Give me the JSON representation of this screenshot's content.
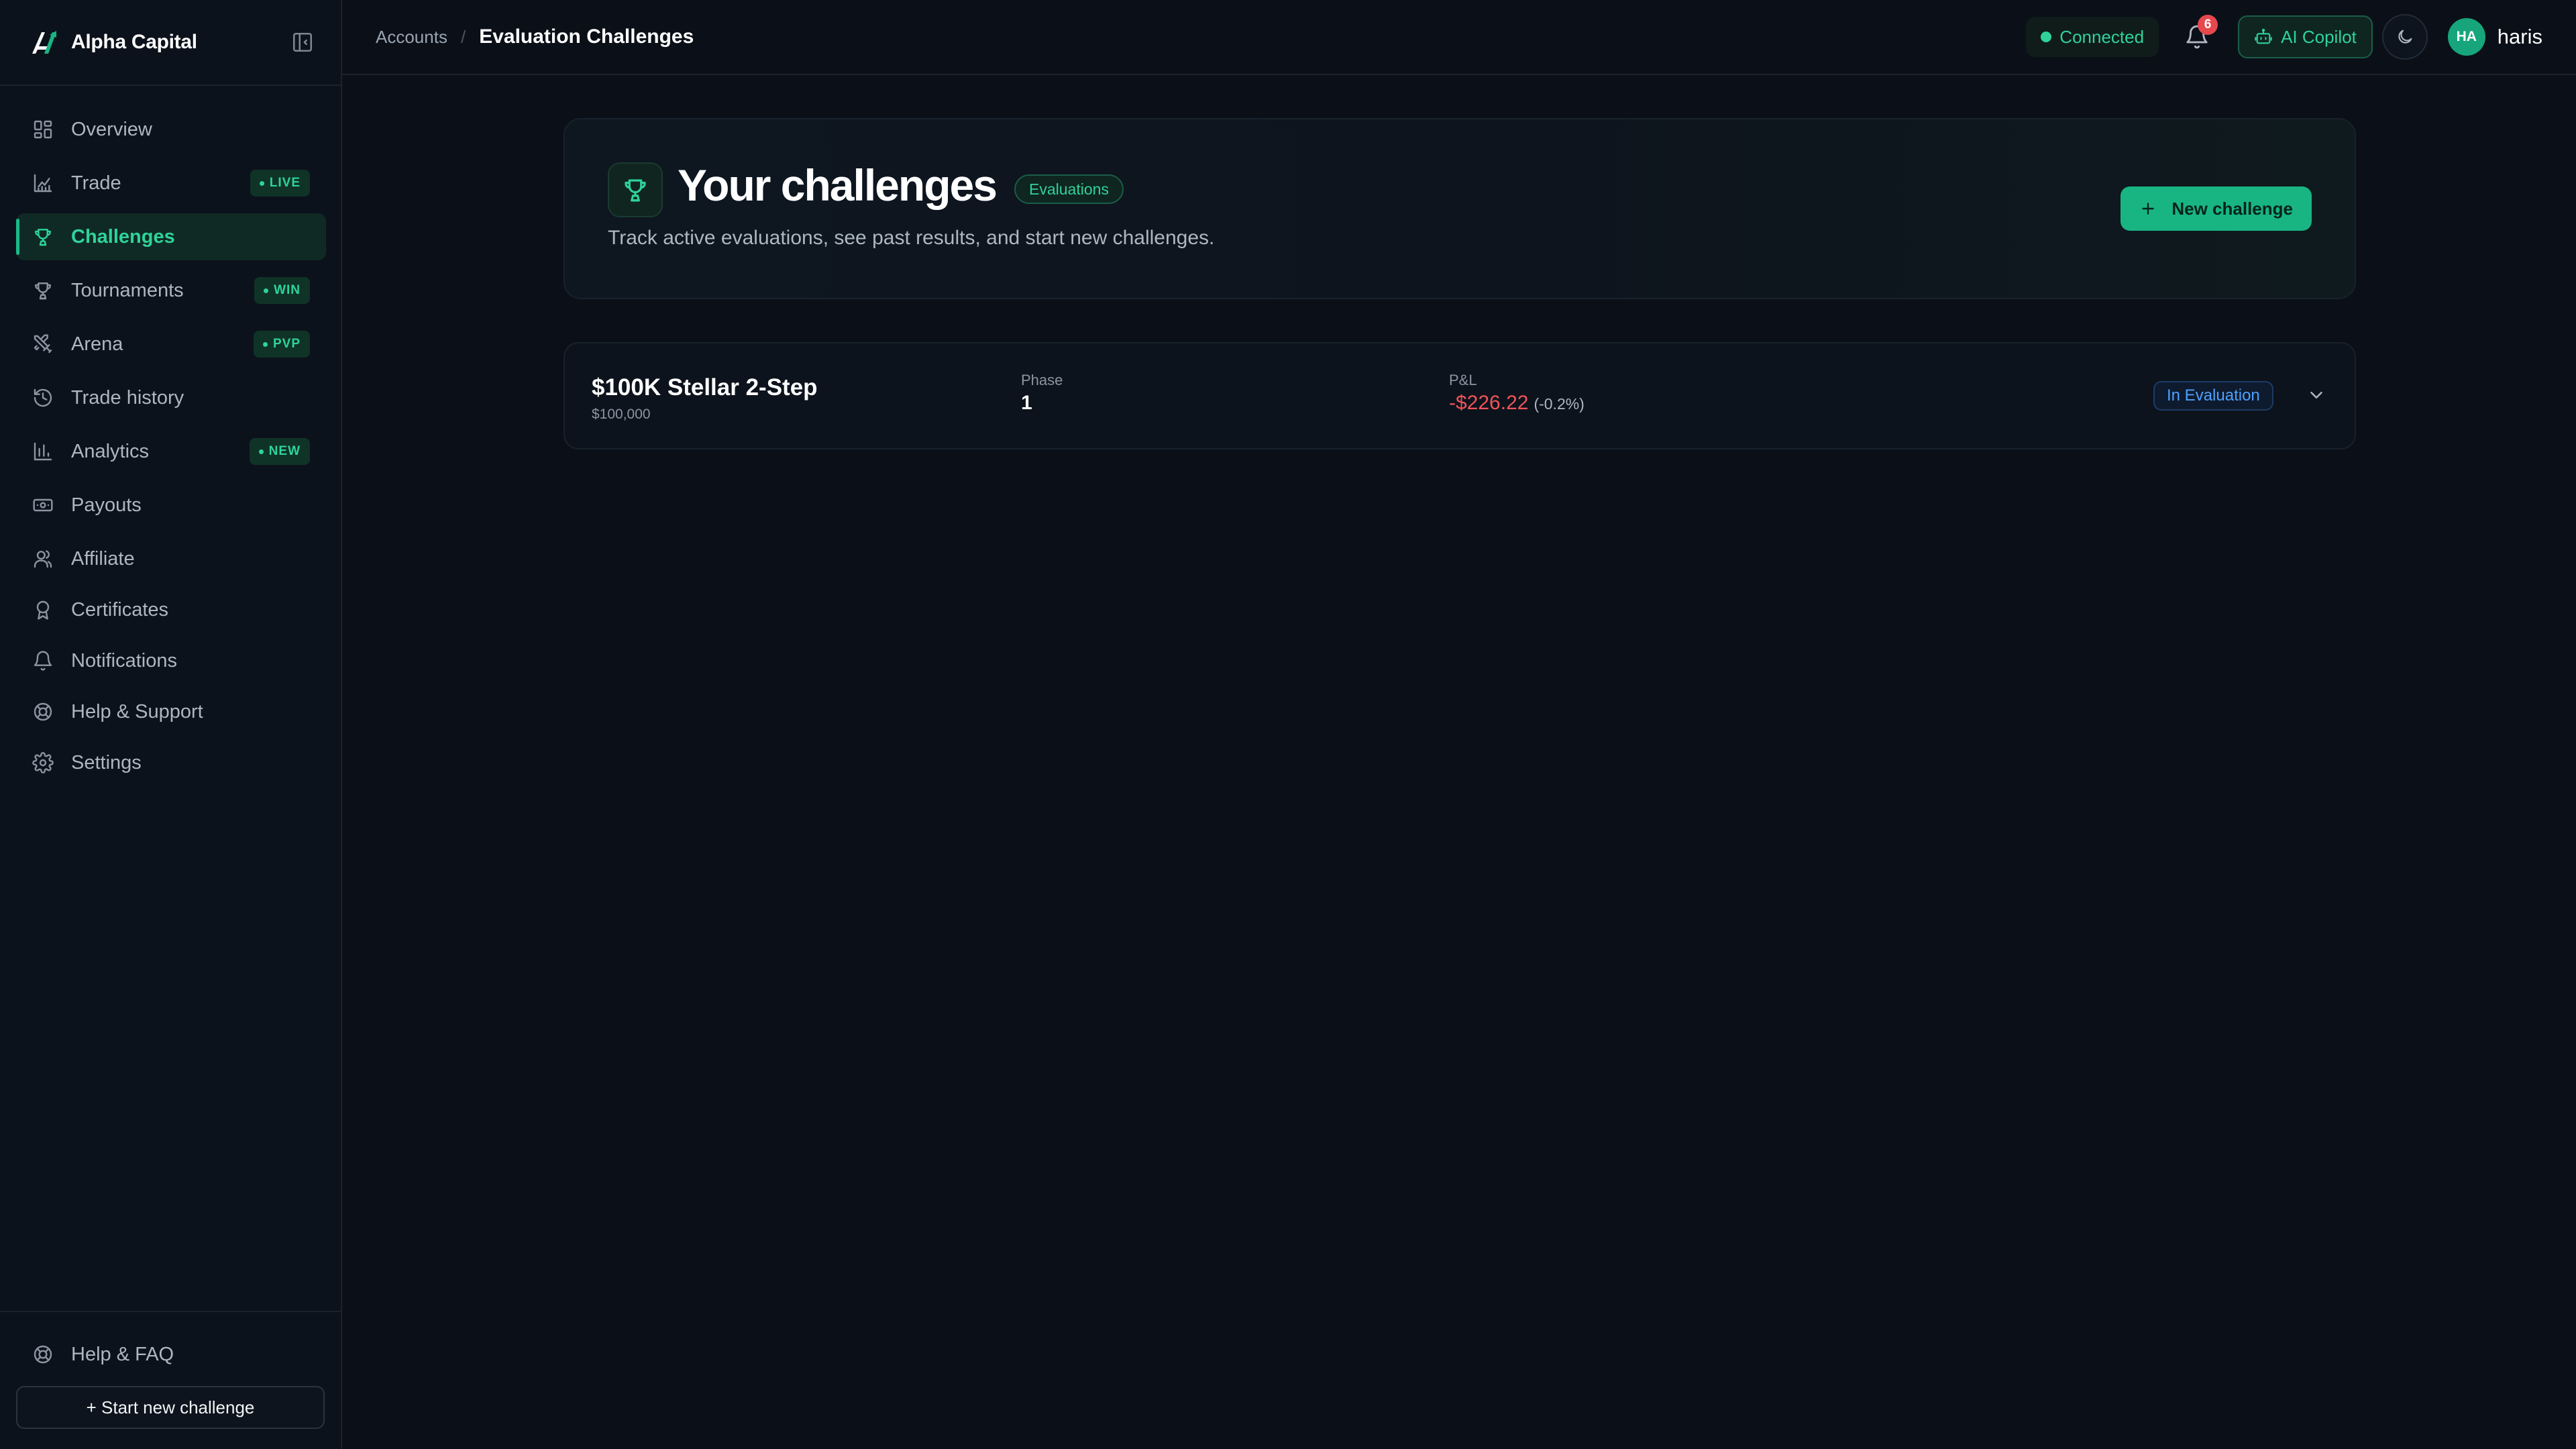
{
  "app": {
    "name": "Alpha Capital",
    "accent_color": "#18b583",
    "logo_icon": "alpha-logo-icon"
  },
  "sidebar": {
    "collapse_icon": "sidebar-collapse-icon",
    "items": [
      {
        "label": "Overview",
        "icon": "grid-icon",
        "active": false,
        "badge": ""
      },
      {
        "label": "Trade",
        "icon": "chart-line-icon",
        "active": false,
        "badge": "LIVE"
      },
      {
        "label": "Challenges",
        "icon": "trophy-icon",
        "active": true,
        "badge": ""
      },
      {
        "label": "Tournaments",
        "icon": "trophy-icon",
        "active": false,
        "badge": "WIN"
      },
      {
        "label": "Arena",
        "icon": "swords-icon",
        "active": false,
        "badge": "PVP"
      },
      {
        "label": "Trade history",
        "icon": "history-icon",
        "active": false,
        "badge": ""
      },
      {
        "label": "Analytics",
        "icon": "bar-chart-icon",
        "active": false,
        "badge": "NEW"
      },
      {
        "label": "Payouts",
        "icon": "banknote-icon",
        "active": false,
        "badge": ""
      },
      {
        "label": "Affiliate",
        "icon": "users-icon",
        "active": false,
        "badge": ""
      },
      {
        "label": "Certificates",
        "icon": "award-icon",
        "active": false,
        "badge": ""
      },
      {
        "label": "Notifications",
        "icon": "bell-icon",
        "active": false,
        "badge": ""
      },
      {
        "label": "Help & Support",
        "icon": "lifebuoy-icon",
        "active": false,
        "badge": ""
      },
      {
        "label": "Settings",
        "icon": "gear-icon",
        "active": false,
        "badge": ""
      }
    ],
    "help_faq": "Help & FAQ",
    "start_button": "+ Start new challenge"
  },
  "topbar": {
    "breadcrumb_root": "Accounts",
    "breadcrumb_sep": "/",
    "breadcrumb_current": "Evaluation Challenges",
    "connection_status": "Connected",
    "notification_count": "6",
    "copilot_label": "AI Copilot",
    "theme_icon": "moon-icon",
    "user_initials": "HA",
    "username": "haris"
  },
  "hero": {
    "title": "Your challenges",
    "chip": "Evaluations",
    "subtitle": "Track active evaluations, see past results, and start new challenges.",
    "new_button": "New challenge"
  },
  "challenges": [
    {
      "name": "$100K Stellar 2-Step",
      "size": "$100,000",
      "phase_label": "Phase",
      "phase": "1",
      "pnl_label": "P&L",
      "pnl": "-$226.22",
      "pnl_pct": "(-0.2%)",
      "status": "In Evaluation"
    }
  ],
  "colors": {
    "positive": "#2fd39a",
    "negative": "#f0545b",
    "status_blue": "#4ea1ff",
    "background": "#0b1018"
  }
}
